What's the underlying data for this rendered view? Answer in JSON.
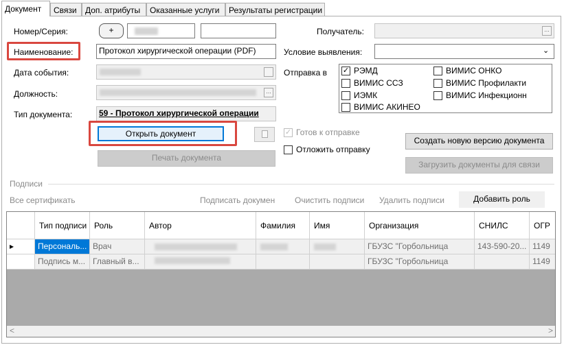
{
  "tabs": [
    "Документ",
    "Связи",
    "Доп. атрибуты",
    "Оказанные услуги",
    "Результаты регистрации"
  ],
  "form": {
    "number_label": "Номер/Серия:",
    "plus_label": "+",
    "name_label": "Наименование:",
    "name_value": "Протокол хирургической операции (PDF)",
    "event_date_label": "Дата события:",
    "position_label": "Должность:",
    "doctype_label": "Тип документа:",
    "doctype_value": "59 - Протокол хирургической операции",
    "open_button": "Открыть документ",
    "print_button": "Печать документа",
    "recipient_label": "Получатель:",
    "detection_label": "Условие выявления:",
    "send_to_label": "Отправка в",
    "send_targets": [
      "РЭМД",
      "ВИМИС ССЗ",
      "ИЭМК",
      "ВИМИС АКИНЕО",
      "ВИМИС ОНКО",
      "ВИМИС Профилакти",
      "ВИМИС Инфекционн"
    ],
    "ready_label": "Готов к отправке",
    "postpone_label": "Отложить отправку",
    "new_version_button": "Создать новую версию документа",
    "load_docs_button": "Загрузить документы для связи",
    "ellipsis": "..."
  },
  "signatures": {
    "group_label": "Подписи",
    "toolbar": [
      "Все сертификать",
      "Подписать докумен",
      "Очистить подписи",
      "Удалить подписи"
    ],
    "add_role_button": "Добавить роль",
    "columns": [
      "Тип подписи",
      "Роль",
      "Автор",
      "Фамилия",
      "Имя",
      "Организация",
      "СНИЛС",
      "ОГР"
    ],
    "rows": [
      [
        "Персональ...",
        "Врач",
        "",
        "",
        "",
        "ГБУЗС \"Горбольница",
        "143-590-20...",
        "1149"
      ],
      [
        "Подпись м...",
        "Главный в...",
        "",
        "",
        "",
        "ГБУЗС \"Горбольница",
        "",
        "1149"
      ]
    ],
    "row_marker": "▸",
    "scroll_left": "<",
    "scroll_right": ">"
  }
}
